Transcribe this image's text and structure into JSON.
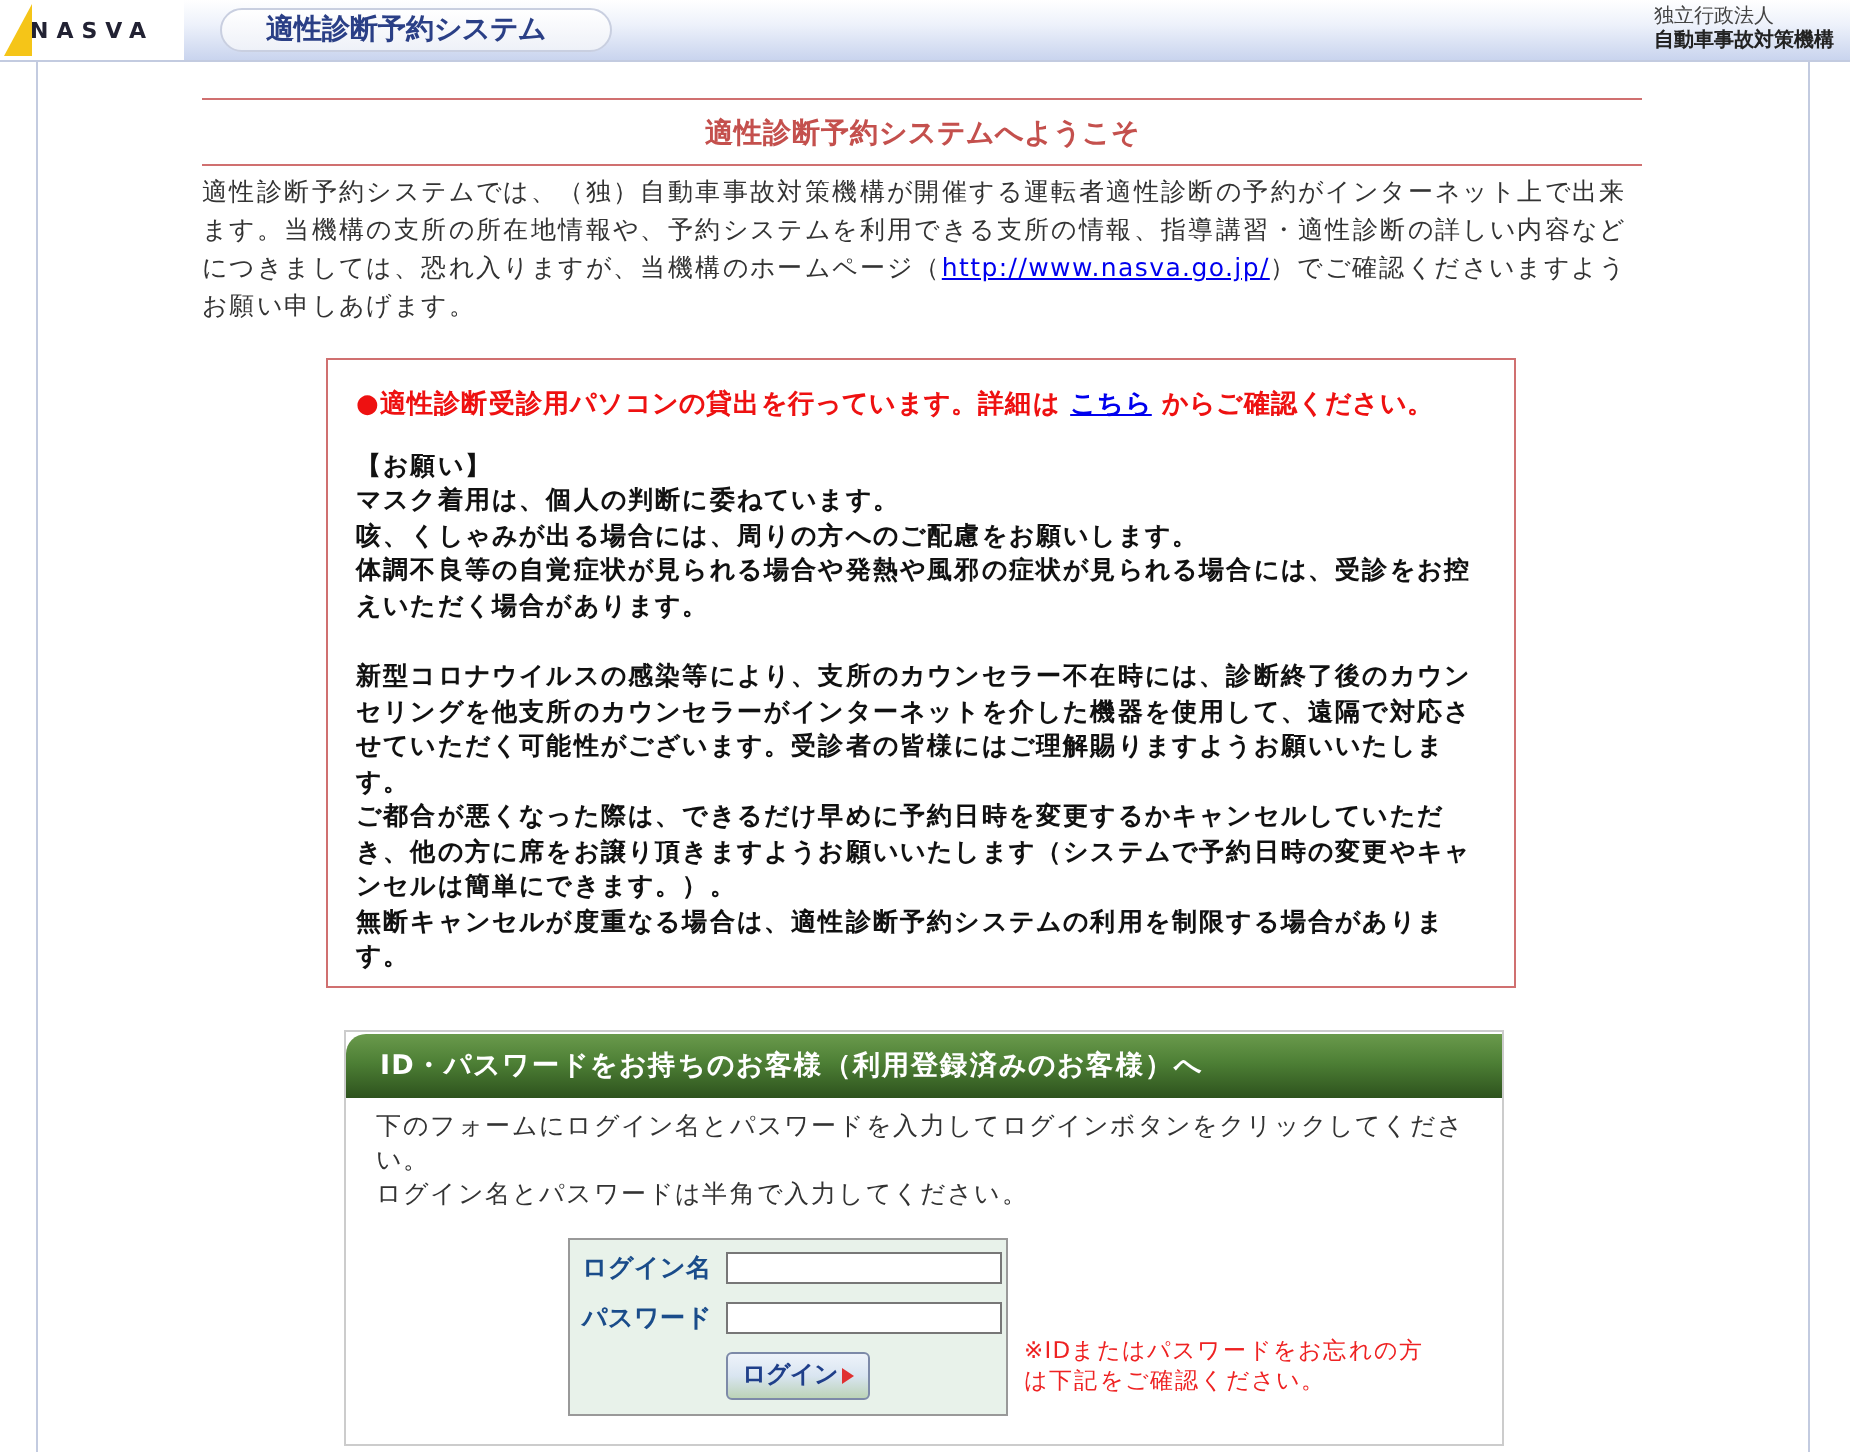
{
  "header": {
    "logo": "NASVA",
    "system_title": "適性診断予約システム",
    "org_lines": [
      "独立行政法人",
      "自動車事故対策機構"
    ]
  },
  "welcome": {
    "title": "適性診断予約システムへようこそ",
    "intro_before": "適性診断予約システムでは、（独）自動車事故対策機構が開催する運転者適性診断の予約がインターネット上で出来ます。当機構の支所の所在地情報や、予約システムを利用できる支所の情報、指導講習・適性診断の詳しい内容などにつきましては、恐れ入りますが、当機構のホームページ（",
    "intro_link": "http://www.nasva.go.jp/",
    "intro_after": "）でご確認くださいますようお願い申しあげます。"
  },
  "notice": {
    "alert_before": "●適性診断受診用パソコンの貸出を行っています。詳細は ",
    "alert_link": "こちら",
    "alert_after": " からご確認ください。",
    "blocks": [
      [
        "【お願い】",
        "マスク着用は、個人の判断に委ねています。",
        "咳、くしゃみが出る場合には、周りの方へのご配慮をお願いします。",
        "体調不良等の自覚症状が見られる場合や発熱や風邪の症状が見られる場合には、受診をお控えいただく場合があります。"
      ],
      [
        "新型コロナウイルスの感染等により、支所のカウンセラー不在時には、診断終了後のカウンセリングを他支所のカウンセラーがインターネットを介した機器を使用して、遠隔で対応させていただく可能性がございます。受診者の皆様にはご理解賜りますようお願いいたします。",
        "ご都合が悪くなった際は、できるだけ早めに予約日時を変更するかキャンセルしていただき、他の方に席をお譲り頂きますようお願いいたします（システムで予約日時の変更やキャンセルは簡単にできます。）。",
        "無断キャンセルが度重なる場合は、適性診断予約システムの利用を制限する場合があります。"
      ]
    ]
  },
  "login": {
    "heading": "ID・パスワードをお持ちのお客様（利用登録済みのお客様）へ",
    "instructions": [
      "下のフォームにログイン名とパスワードを入力してログインボタンをクリックしてください。",
      "ログイン名とパスワードは半角で入力してください。"
    ],
    "fields": [
      {
        "label": "ログイン名"
      },
      {
        "label": "パスワード"
      }
    ],
    "button": "ログイン",
    "forgot_note": "※IDまたはパスワードをお忘れの方は下記をご確認ください。"
  }
}
